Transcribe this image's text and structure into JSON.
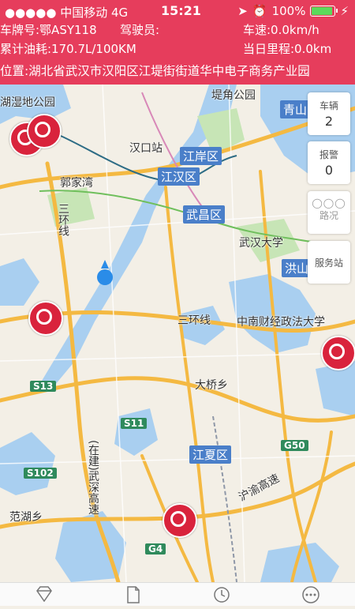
{
  "status_bar": {
    "carrier": "●●●●● 中国移动",
    "network": "4G",
    "time": "15:21",
    "battery": "100%"
  },
  "vehicle": {
    "plate": "车牌号:鄂ASY118",
    "driver": "驾驶员:",
    "speed": "车速:0.0km/h",
    "fuel": "累计油耗:170.7L/100KM",
    "mileage": "当日里程:0.0km",
    "location": "位置:湖北省武汉市汉阳区江堤街街道华中电子商务产业园"
  },
  "side_panels": {
    "vehicles": {
      "label": "车辆",
      "count": "2"
    },
    "alarm": {
      "label": "报警",
      "count": "0"
    },
    "route": {
      "label": "路况"
    },
    "service": {
      "label": "服务站"
    }
  },
  "map": {
    "districts": [
      "青山",
      "江岸区",
      "江汉区",
      "武昌区",
      "洪山",
      "江夏区"
    ],
    "places": [
      "湖湿地公园",
      "堤角公园",
      "汉口站",
      "郭家湾",
      "三环线",
      "武汉大学",
      "三环线",
      "中南财经政法大学",
      "大桥乡",
      "(在建)武深高速",
      "沪渝高速",
      "范湖乡"
    ],
    "roads": [
      "S13",
      "S11",
      "S102",
      "G50",
      "G4"
    ]
  },
  "colors": {
    "header": "#e63d5c",
    "marker": "#d9233c"
  }
}
